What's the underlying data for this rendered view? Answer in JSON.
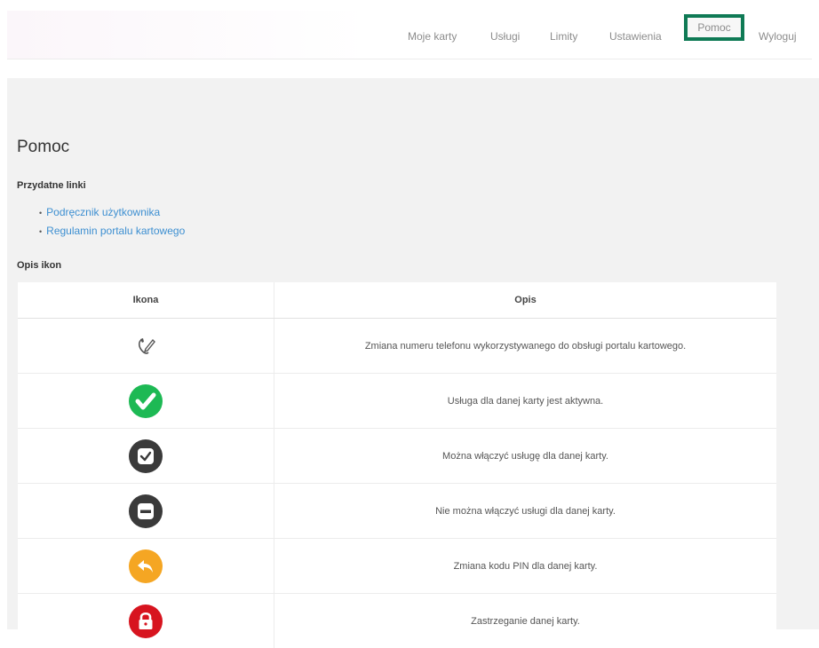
{
  "nav": {
    "items": [
      "Moje karty",
      "Usługi",
      "Limity",
      "Ustawienia",
      "Pomoc",
      "Wyloguj"
    ],
    "active": "Pomoc"
  },
  "page": {
    "title": "Pomoc",
    "useful_links_heading": "Przydatne linki",
    "links": [
      "Podręcznik użytkownika",
      "Regulamin portalu kartowego"
    ],
    "icons_heading": "Opis ikon"
  },
  "table": {
    "headers": [
      "Ikona",
      "Opis"
    ],
    "rows": [
      {
        "icon": "phone-edit-icon",
        "desc": "Zmiana numeru telefonu wykorzystywanego do obsługi portalu kartowego."
      },
      {
        "icon": "active-check-icon",
        "desc": "Usługa dla danej karty jest aktywna."
      },
      {
        "icon": "enable-check-icon",
        "desc": "Można włączyć usługę dla danej karty."
      },
      {
        "icon": "disabled-minus-icon",
        "desc": "Nie można włączyć usługi dla danej karty."
      },
      {
        "icon": "pin-change-icon",
        "desc": "Zmiana kodu PIN dla danej karty."
      },
      {
        "icon": "lock-card-icon",
        "desc": "Zastrzeganie danej karty."
      }
    ]
  },
  "colors": {
    "active_border": "#0f7a55",
    "link": "#3d8fd1",
    "active_icon": "#1db954",
    "pin_icon": "#f5a623",
    "lock_icon": "#d7141f",
    "dark_icon": "#3a3a3a"
  }
}
